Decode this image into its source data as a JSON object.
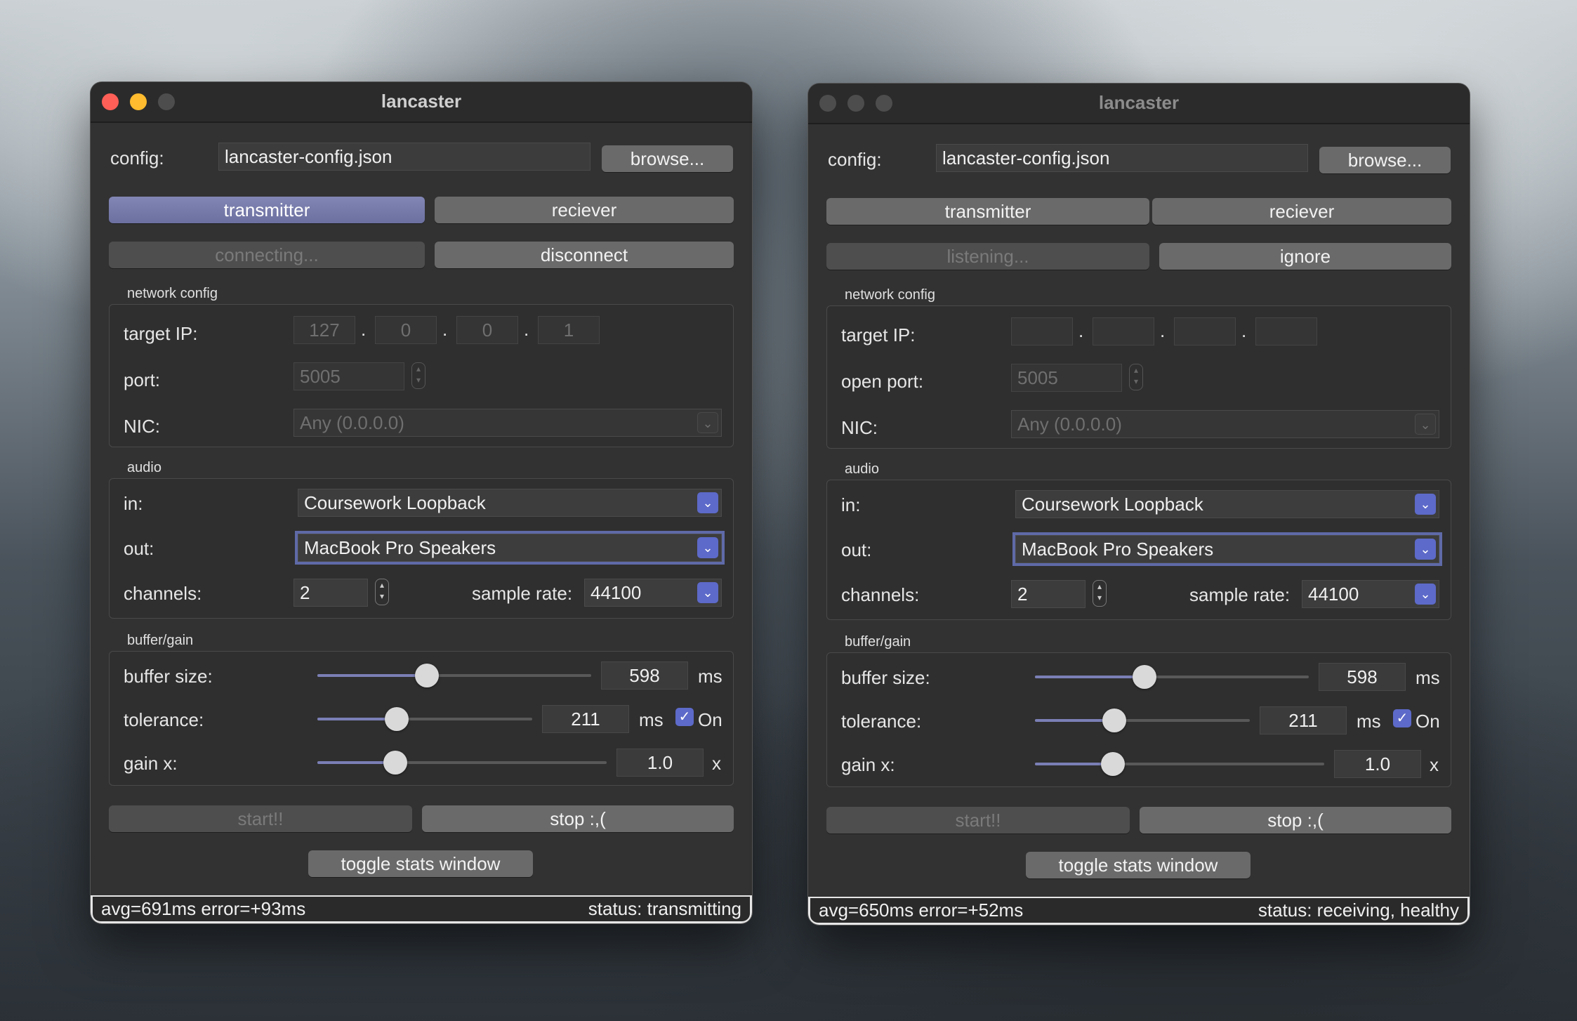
{
  "windows": [
    {
      "title": "lancaster",
      "config_label": "config:",
      "config_value": "lancaster-config.json",
      "browse_label": "browse...",
      "tab_transmitter": "transmitter",
      "tab_receiver": "reciever",
      "conn_status": "connecting...",
      "conn_action": "disconnect",
      "network_title": "network config",
      "target_ip_label": "target IP:",
      "ip": [
        "127",
        "0",
        "0",
        "1"
      ],
      "port_label": "port:",
      "port_value": "5005",
      "nic_label": "NIC:",
      "nic_value": "Any (0.0.0.0)",
      "audio_title": "audio",
      "in_label": "in:",
      "in_value": "Coursework Loopback",
      "out_label": "out:",
      "out_value": "MacBook Pro Speakers",
      "channels_label": "channels:",
      "channels_value": "2",
      "sample_rate_label": "sample rate:",
      "sample_rate_value": "44100",
      "buffer_title": "buffer/gain",
      "buffer_label": "buffer size:",
      "buffer_value": "598",
      "buffer_unit": "ms",
      "buffer_level": 0.4,
      "tolerance_label": "tolerance:",
      "tolerance_value": "211",
      "tolerance_unit": "ms",
      "tolerance_level": 0.37,
      "tolerance_on": "On",
      "gain_label": "gain x:",
      "gain_value": "1.0",
      "gain_unit": "x",
      "gain_level": 0.27,
      "start_label": "start!!",
      "stop_label": "stop :,(",
      "toggle_stats_label": "toggle stats window",
      "stats_text": "avg=691ms  error=+93ms",
      "status_text": "status: transmitting"
    },
    {
      "title": "lancaster",
      "config_label": "config:",
      "config_value": "lancaster-config.json",
      "browse_label": "browse...",
      "tab_transmitter": "transmitter",
      "tab_receiver": "reciever",
      "conn_status": "listening...",
      "conn_action": "ignore",
      "network_title": "network config",
      "target_ip_label": "target IP:",
      "ip": [
        "",
        "",
        "",
        ""
      ],
      "port_label": "open port:",
      "port_value": "5005",
      "nic_label": "NIC:",
      "nic_value": "Any (0.0.0.0)",
      "audio_title": "audio",
      "in_label": "in:",
      "in_value": "Coursework Loopback",
      "out_label": "out:",
      "out_value": "MacBook Pro Speakers",
      "channels_label": "channels:",
      "channels_value": "2",
      "sample_rate_label": "sample rate:",
      "sample_rate_value": "44100",
      "buffer_title": "buffer/gain",
      "buffer_label": "buffer size:",
      "buffer_value": "598",
      "buffer_unit": "ms",
      "buffer_level": 0.4,
      "tolerance_label": "tolerance:",
      "tolerance_value": "211",
      "tolerance_unit": "ms",
      "tolerance_level": 0.37,
      "tolerance_on": "On",
      "gain_label": "gain x:",
      "gain_value": "1.0",
      "gain_unit": "x",
      "gain_level": 0.27,
      "start_label": "start!!",
      "stop_label": "stop :,(",
      "toggle_stats_label": "toggle stats window",
      "stats_text": "avg=650ms  error=+52ms",
      "status_text": "status: receiving, healthy"
    }
  ],
  "colors": {
    "accent": "#5d6ac9",
    "selected_tab": "#7b7fb6",
    "close": "#ff5f57",
    "minimize": "#febc2e"
  },
  "icons": {
    "dropdown": "chevron-down-icon",
    "stepper": "up-down-stepper-icon",
    "check": "checkmark-icon"
  }
}
